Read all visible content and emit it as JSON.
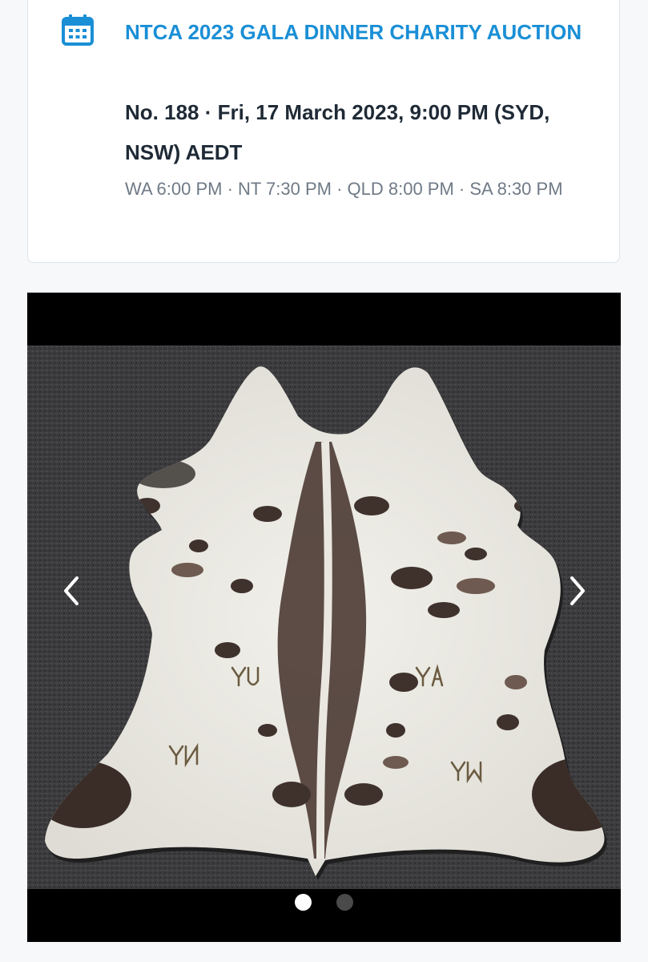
{
  "event": {
    "icon": "calendar-icon",
    "title": "NTCA 2023 GALA DINNER CHARITY AUCTION",
    "lot_line": "No. 188 · Fri, 17 March 2023, 9:00 PM (SYD, NSW) AEDT",
    "timezones": "WA 6:00 PM · NT 7:30 PM · QLD 8:00 PM · SA 8:30 PM"
  },
  "gallery": {
    "image": "cowhide-rug-photo",
    "prev_icon": "chevron-left-icon",
    "next_icon": "chevron-right-icon",
    "slide_count": 2,
    "active_slide": 1,
    "brand_marks": [
      "YN",
      "YM",
      "YA",
      "YU"
    ]
  },
  "colors": {
    "accent": "#1a8fd6",
    "text": "#1f2a36",
    "muted": "#6f7a86",
    "carpet": "#3d3d3f",
    "hide_white": "#ecebe6",
    "hide_dark": "#4a3a34"
  }
}
